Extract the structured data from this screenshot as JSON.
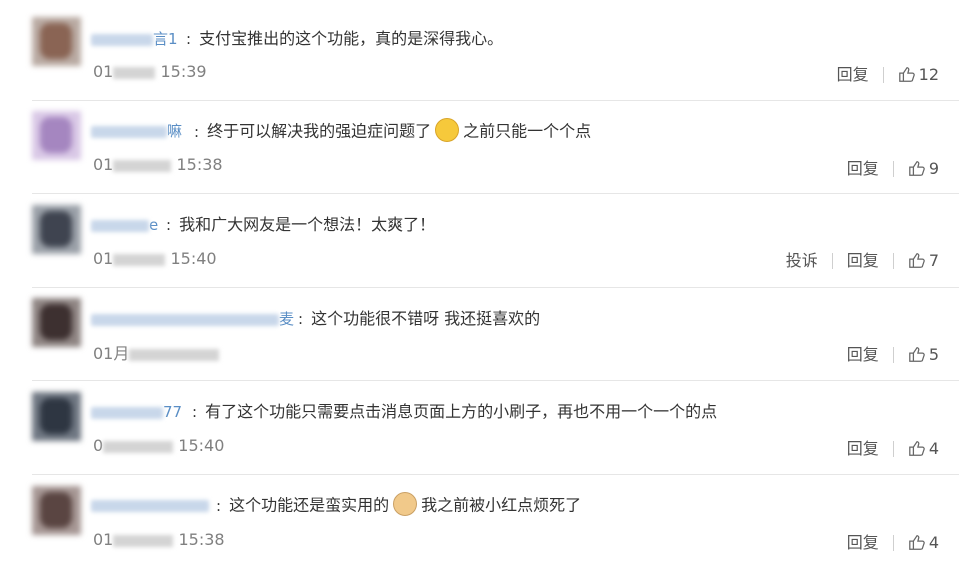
{
  "comments": [
    {
      "name_visible": "言1",
      "text": "支付宝推出的这个功能，真的是深得我心。",
      "time_prefix": "01",
      "time_visible": "15:39",
      "report": "",
      "reply": "回复",
      "likes": "12",
      "avatar_color": "#9a7a6a"
    },
    {
      "name_visible": "嘛",
      "text_before": "终于可以解决我的强迫症问题了",
      "emoji": "crying-laugh-emoji",
      "text_after": "之前只能一个个点",
      "time_prefix": "01",
      "time_visible": "15:38",
      "report": "",
      "reply": "回复",
      "likes": "9",
      "avatar_color": "#b59acb"
    },
    {
      "name_visible": "e",
      "text": "我和广大网友是一个想法！太爽了！",
      "time_prefix": "01",
      "time_visible": "15:40",
      "report": "投诉",
      "reply": "回复",
      "likes": "7",
      "avatar_color": "#4a4f5a"
    },
    {
      "name_visible": "麦",
      "text": "这个功能很不错呀 我还挺喜欢的",
      "time_prefix": "01月",
      "time_visible": "",
      "report": "",
      "reply": "回复",
      "likes": "5",
      "avatar_color": "#5c4a48"
    },
    {
      "name_visible": "77",
      "text": "有了这个功能只需要点击消息页面上方的小刷子，再也不用一个一个的点",
      "time_prefix": "0",
      "time_visible": "15:40",
      "report": "",
      "reply": "回复",
      "likes": "4",
      "avatar_color": "#3d4a5a"
    },
    {
      "name_visible": "",
      "text_before": "这个功能还是蛮实用的",
      "emoji": "dog-emoji",
      "text_after": "我之前被小红点烦死了",
      "time_prefix": "01",
      "time_visible": "15:38",
      "report": "",
      "reply": "回复",
      "likes": "4",
      "avatar_color": "#6a5550"
    }
  ],
  "colors": {
    "name": "#5a8ec5",
    "text": "#333333",
    "time": "#808080",
    "divider": "#e6e6e6"
  }
}
